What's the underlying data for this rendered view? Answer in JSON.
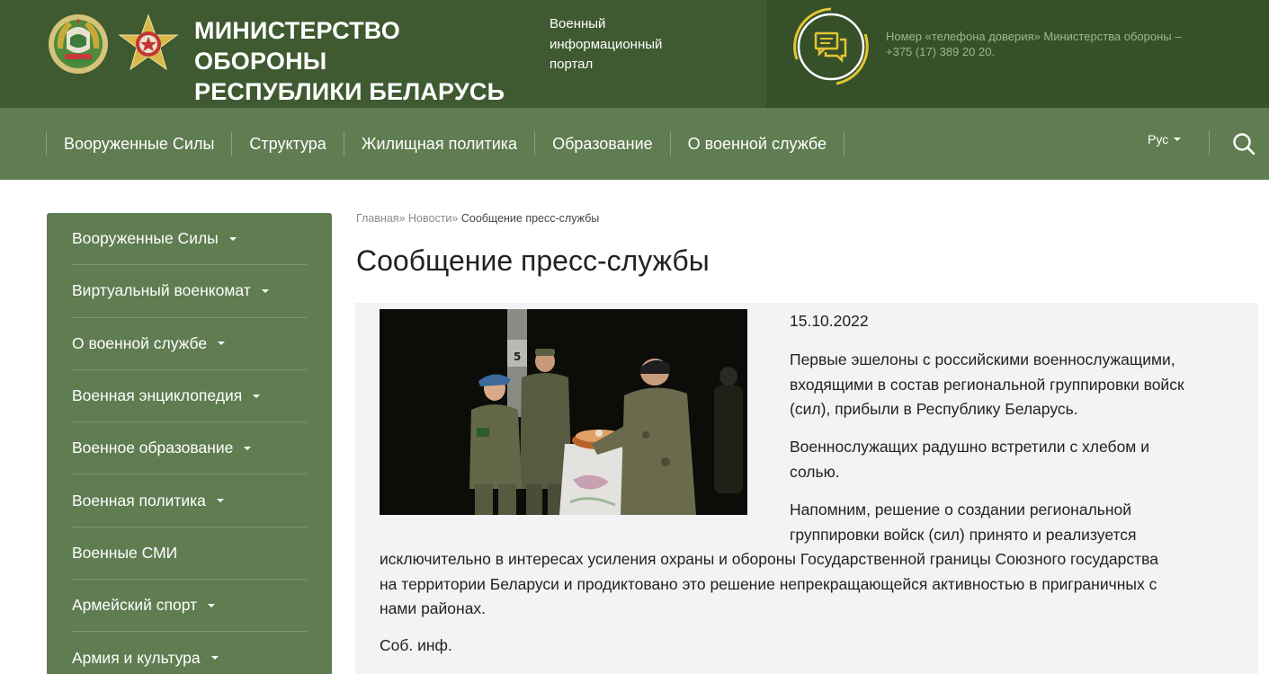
{
  "header": {
    "title_line1": "МИНИСТЕРСТВО ОБОРОНЫ",
    "title_line2": "РЕСПУБЛИКИ БЕЛАРУСЬ",
    "portal_line1": "Военный",
    "portal_line2": "информационный",
    "portal_line3": "портал",
    "hotline_line1": "Номер «телефона доверия» Министерства обороны –",
    "hotline_line2": "+375 (17) 389 20 20.",
    "emblem1_icon": "state-emblem-icon",
    "emblem2_icon": "army-star-emblem-icon",
    "hotline_icon": "chat-bubbles-icon"
  },
  "nav": {
    "items": [
      {
        "label": "Вооруженные Силы"
      },
      {
        "label": "Структура"
      },
      {
        "label": "Жилищная политика"
      },
      {
        "label": "Образование"
      },
      {
        "label": "О военной службе"
      }
    ],
    "language": "Рус",
    "search_icon": "search-icon"
  },
  "sidebar": {
    "items": [
      {
        "label": "Вооруженные Силы",
        "has_dropdown": true
      },
      {
        "label": "Виртуальный военкомат",
        "has_dropdown": true
      },
      {
        "label": "О военной службе",
        "has_dropdown": true
      },
      {
        "label": "Военная энциклопедия",
        "has_dropdown": true
      },
      {
        "label": "Военное образование",
        "has_dropdown": true
      },
      {
        "label": "Военная политика",
        "has_dropdown": true
      },
      {
        "label": "Военные СМИ",
        "has_dropdown": false
      },
      {
        "label": "Армейский спорт",
        "has_dropdown": true
      },
      {
        "label": "Армия и культура",
        "has_dropdown": true
      }
    ]
  },
  "breadcrumb": {
    "home": "Главная",
    "section": "Новости",
    "separator": "»",
    "current": "Сообщение пресс-службы"
  },
  "article": {
    "title": "Сообщение пресс-службы",
    "date": "15.10.2022",
    "p1_lines": [
      "Первые эшелоны с российскими военнослужащими,",
      "входящими в состав региональной группировки войск",
      "(сил), прибыли в Республику Беларусь."
    ],
    "p2_lines": [
      "Военнослужащих радушно встретили с хлебом и",
      "солью."
    ],
    "p3_lines_a": [
      "Напомним, решение о создании региональной",
      "группировки войск (сил) принято и реализуется"
    ],
    "p3_lines_b": [
      "исключительно в интересах усиления охраны и обороны Государственной границы Союзного государства",
      "на территории Беларуси и продиктовано это решение непрекращающейся активностью в приграничных с",
      "нами районах."
    ],
    "signature": "Соб. инф.",
    "photo_post_marker": "5"
  },
  "colors": {
    "header_bg": "#3f5a31",
    "header_right_bg": "#36502a",
    "nav_bg": "#5f7d51",
    "accent_yellow": "#e3c531",
    "article_bg": "#f2f3f4"
  }
}
